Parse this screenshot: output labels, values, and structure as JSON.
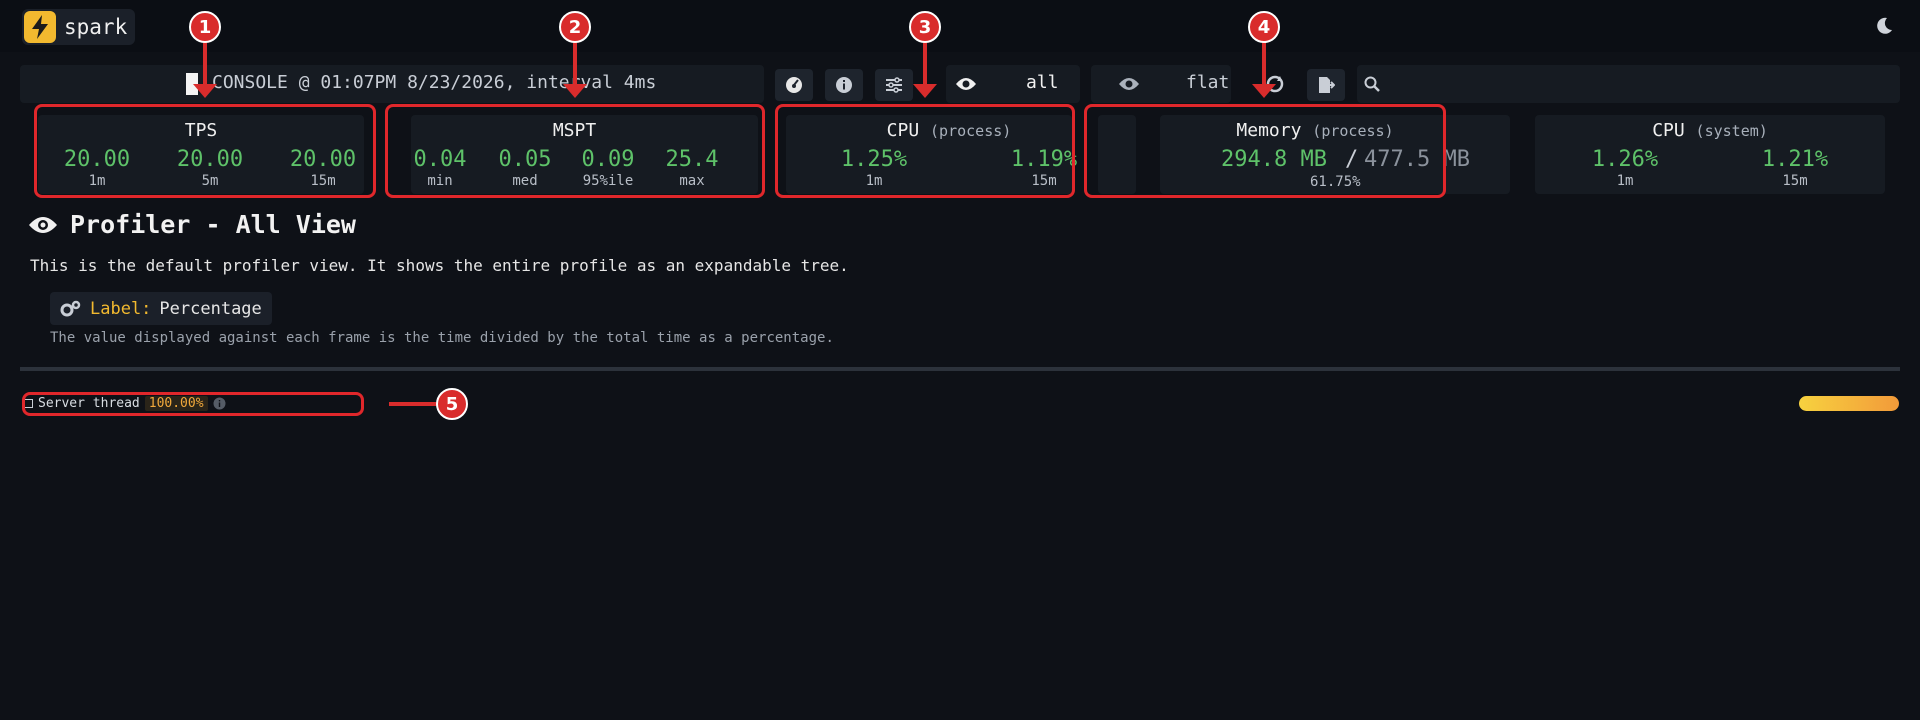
{
  "header": {
    "brand": "spark",
    "theme_icon": "moon-icon"
  },
  "toolbar": {
    "session": "CONSOLE @ 01:07PM 8/23/2026, interval 4ms",
    "view_label": "all",
    "tree_mode_label": "flat"
  },
  "widgets": {
    "tps": {
      "title": "TPS",
      "values": [
        {
          "value": "20.00",
          "label": "1m"
        },
        {
          "value": "20.00",
          "label": "5m"
        },
        {
          "value": "20.00",
          "label": "15m"
        }
      ]
    },
    "mspt": {
      "title": "MSPT",
      "values": [
        {
          "value": "0.04",
          "label": "min"
        },
        {
          "value": "0.05",
          "label": "med"
        },
        {
          "value": "0.09",
          "label": "95%ile"
        },
        {
          "value": "25.4",
          "label": "max"
        }
      ]
    },
    "cpu_process": {
      "title": "CPU",
      "subtitle": "(process)",
      "values": [
        {
          "value": "1.25%",
          "label": "1m"
        },
        {
          "value": "1.19%",
          "label": "15m"
        }
      ]
    },
    "memory": {
      "title": "Memory",
      "subtitle": "(process)",
      "used": "294.8 MB",
      "separator": "/",
      "total": "477.5 MB",
      "percent": "61.75%"
    },
    "cpu_system": {
      "title": "CPU",
      "subtitle": "(system)",
      "values": [
        {
          "value": "1.26%",
          "label": "1m"
        },
        {
          "value": "1.21%",
          "label": "15m"
        }
      ]
    }
  },
  "view": {
    "title": "Profiler - All View",
    "description": "This is the default profiler view. It shows the entire profile as an expandable tree.",
    "label_key": "Label:",
    "label_value": "Percentage",
    "note": "The value displayed against each frame is the time divided by the total time as a percentage."
  },
  "tree": {
    "root_name": "Server thread",
    "root_percent": "100.00%"
  },
  "annotations": [
    "1",
    "2",
    "3",
    "4",
    "5"
  ],
  "colors": {
    "accent": "#f2b92f",
    "positive": "#5ec269",
    "annotation": "#d92c2c"
  }
}
